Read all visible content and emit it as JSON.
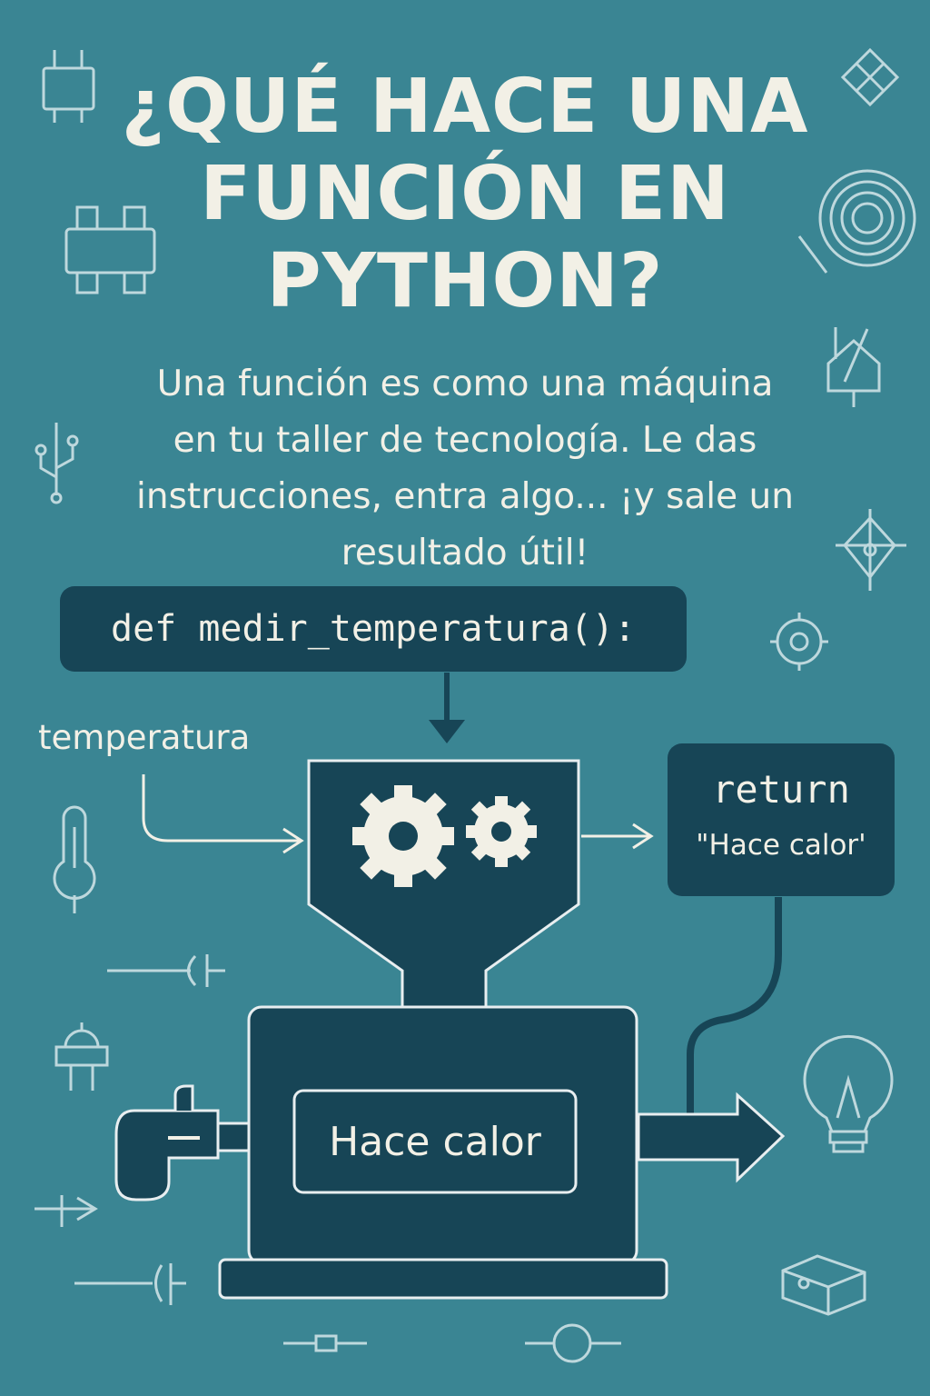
{
  "title_lines": [
    "¿QUÉ HACE UNA",
    "FUNCIÓN EN",
    "PYTHON?"
  ],
  "subtitle_lines": [
    "Una función es como una máquina",
    "en tu taller de tecnología. Le das",
    "instrucciones, entra algo... ¡y sale un",
    "resultado útil!"
  ],
  "code_definition": "def medir_temperatura():",
  "input_label": "temperatura",
  "return_box": {
    "keyword": "return",
    "value": "\"Hace calor'"
  },
  "output_display": "Hace calor",
  "colors": {
    "background": "#3a8593",
    "machine": "#174556",
    "text": "#f2f0e6",
    "line_art": "#d6e7ea"
  },
  "icons": [
    "plug-icon",
    "diamond-pattern-icon",
    "chip-icon",
    "spiral-icon",
    "house-circuit-icon",
    "usb-icon",
    "tree-ornament-icon",
    "gear-icon",
    "thermometer-icon",
    "capacitor-icon",
    "power-plug-icon",
    "lightbulb-icon",
    "arrow-resistor-icon",
    "circuit-symbol-icon",
    "resistor-icon",
    "circle-node-icon",
    "box-3d-icon"
  ]
}
